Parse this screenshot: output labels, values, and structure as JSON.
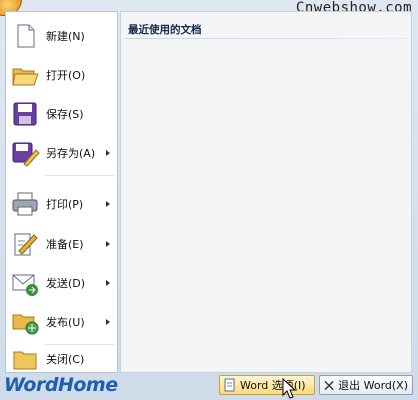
{
  "watermark": "Cnwebshow.com",
  "recent": {
    "title": "最近使用的文档"
  },
  "menu": {
    "items": [
      {
        "label": "新建(N)",
        "icon": "new-document-icon",
        "submenu": false
      },
      {
        "label": "打开(O)",
        "icon": "open-folder-icon",
        "submenu": false
      },
      {
        "label": "保存(S)",
        "icon": "save-disk-icon",
        "submenu": false
      },
      {
        "label": "另存为(A)",
        "icon": "save-as-icon",
        "submenu": true
      },
      {
        "label": "打印(P)",
        "icon": "printer-icon",
        "submenu": true
      },
      {
        "label": "准备(E)",
        "icon": "prepare-icon",
        "submenu": true
      },
      {
        "label": "发送(D)",
        "icon": "send-icon",
        "submenu": true
      },
      {
        "label": "发布(U)",
        "icon": "publish-icon",
        "submenu": true
      },
      {
        "label": "关闭(C)",
        "icon": "close-folder-icon",
        "submenu": false
      }
    ]
  },
  "footer": {
    "brand": "WordHome",
    "word_options_label": "Word 选项(I)",
    "exit_label": "退出 Word(X)"
  },
  "colors": {
    "brand": "#1f5fae",
    "accent": "#ffd975",
    "frame": "#dfe7f1"
  }
}
